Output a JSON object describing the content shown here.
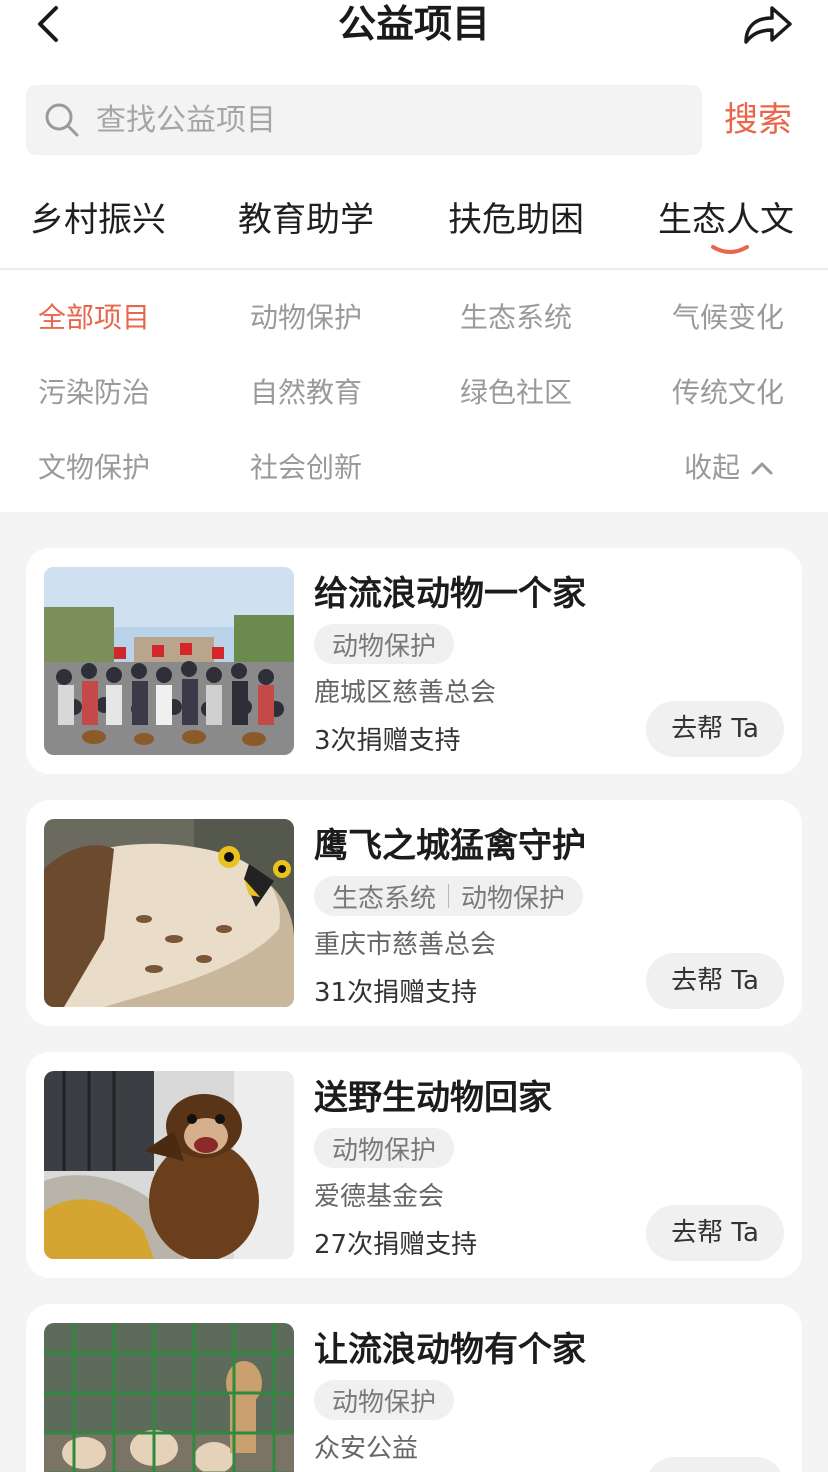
{
  "header": {
    "title": "公益项目",
    "back_icon": "chevron-left-icon",
    "share_icon": "share-arrow-icon"
  },
  "search": {
    "placeholder": "查找公益项目",
    "value": "",
    "button_label": "搜索",
    "icon": "search-icon"
  },
  "category_tabs": [
    {
      "label": "乡村振兴",
      "active": false
    },
    {
      "label": "教育助学",
      "active": false
    },
    {
      "label": "扶危助困",
      "active": false
    },
    {
      "label": "生态人文",
      "active": true
    }
  ],
  "sub_tags": [
    {
      "label": "全部项目",
      "active": true
    },
    {
      "label": "动物保护",
      "active": false
    },
    {
      "label": "生态系统",
      "active": false
    },
    {
      "label": "气候变化",
      "active": false
    },
    {
      "label": "污染防治",
      "active": false
    },
    {
      "label": "自然教育",
      "active": false
    },
    {
      "label": "绿色社区",
      "active": false
    },
    {
      "label": "传统文化",
      "active": false
    },
    {
      "label": "文物保护",
      "active": false
    },
    {
      "label": "社会创新",
      "active": false
    }
  ],
  "collapse_label": "收起",
  "projects": [
    {
      "title": "给流浪动物一个家",
      "tags": [
        "动物保护"
      ],
      "org": "鹿城区慈善总会",
      "count": "3次捐赠支持",
      "button": "去帮 Ta",
      "image": "group-photo-with-dogs"
    },
    {
      "title": "鹰飞之城猛禽守护",
      "tags": [
        "生态系统",
        "动物保护"
      ],
      "org": "重庆市慈善总会",
      "count": "31次捐赠支持",
      "button": "去帮 Ta",
      "image": "hawk-photo"
    },
    {
      "title": "送野生动物回家",
      "tags": [
        "动物保护"
      ],
      "org": "爱德基金会",
      "count": "27次捐赠支持",
      "button": "去帮 Ta",
      "image": "weasel-on-glove-photo"
    },
    {
      "title": "让流浪动物有个家",
      "tags": [
        "动物保护"
      ],
      "org": "众安公益",
      "count": "",
      "button": "",
      "image": "dogs-in-cage-photo"
    }
  ],
  "colors": {
    "accent": "#e8664a",
    "page_bg": "#f4f4f4",
    "card_bg": "#ffffff",
    "pill_bg": "#f0f0f0"
  }
}
